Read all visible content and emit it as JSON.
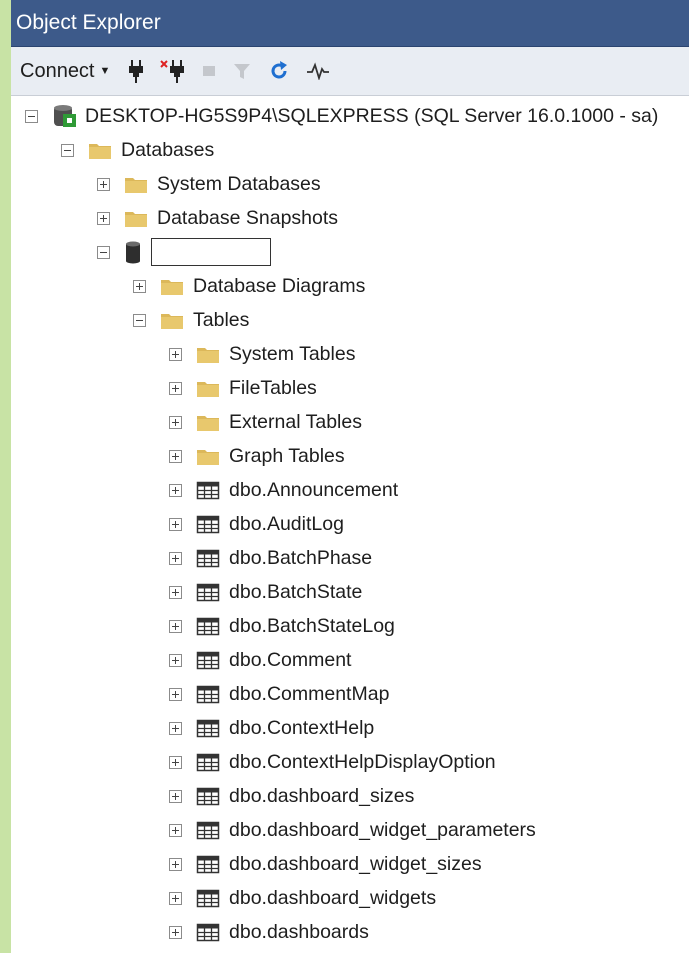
{
  "panel": {
    "title": "Object Explorer"
  },
  "toolbar": {
    "connect_label": "Connect",
    "buttons": [
      "connect-plug-icon",
      "disconnect-plug-icon",
      "stop-icon",
      "filter-icon",
      "refresh-icon",
      "activity-monitor-icon"
    ]
  },
  "tree": {
    "server": "DESKTOP-HG5S9P4\\SQLEXPRESS (SQL Server 16.0.1000 - sa)",
    "databases": "Databases",
    "system_databases": "System Databases",
    "database_snapshots": "Database Snapshots",
    "database_name": "",
    "database_diagrams": "Database Diagrams",
    "tables": "Tables",
    "table_folders": [
      "System Tables",
      "FileTables",
      "External Tables",
      "Graph Tables"
    ],
    "table_items": [
      "dbo.Announcement",
      "dbo.AuditLog",
      "dbo.BatchPhase",
      "dbo.BatchState",
      "dbo.BatchStateLog",
      "dbo.Comment",
      "dbo.CommentMap",
      "dbo.ContextHelp",
      "dbo.ContextHelpDisplayOption",
      "dbo.dashboard_sizes",
      "dbo.dashboard_widget_parameters",
      "dbo.dashboard_widget_sizes",
      "dbo.dashboard_widgets",
      "dbo.dashboards"
    ]
  },
  "colors": {
    "titlebar": "#3d5a8a",
    "toolbar": "#e9edf3",
    "folder": "#dcb85a",
    "accent_green": "#c8e3a5"
  }
}
